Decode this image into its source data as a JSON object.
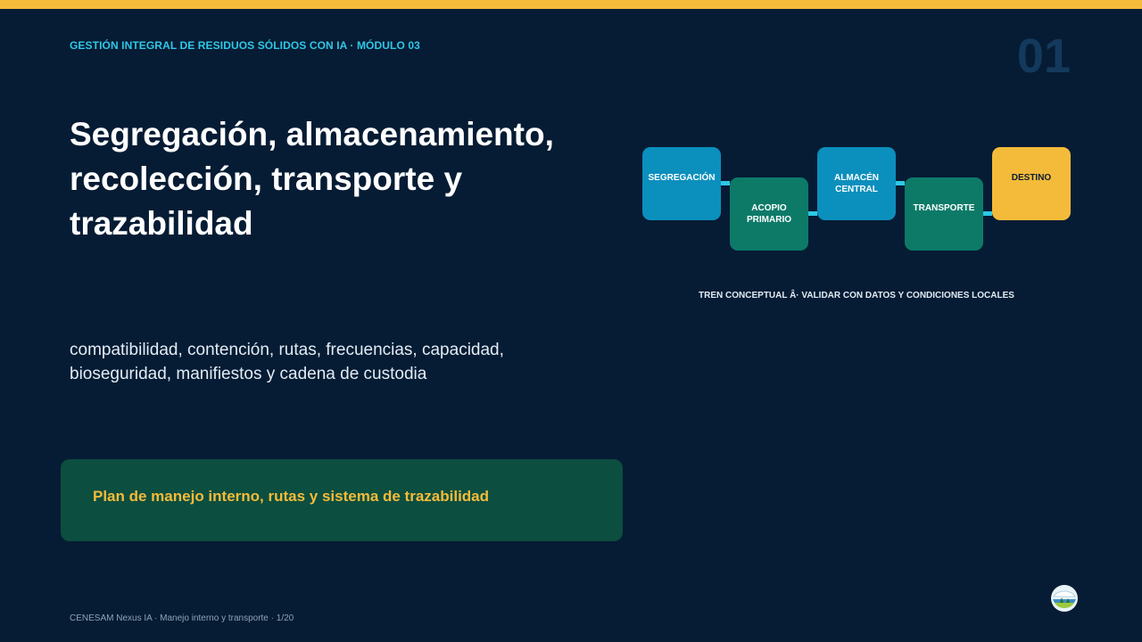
{
  "header": {
    "eyebrow": "GESTIÓN INTEGRAL DE RESIDUOS SÓLIDOS CON IA · MÓDULO 03",
    "slide_number": "01"
  },
  "main": {
    "title": "Segregación, almacenamiento, recolección, transporte y trazabilidad",
    "subtitle": "compatibilidad, contención, rutas, frecuencias, capacidad, bioseguridad, manifiestos y cadena de custodia",
    "callout": "Plan de manejo interno, rutas y sistema de trazabilidad"
  },
  "flow": {
    "steps": [
      {
        "label": "SEGREGACIÓN",
        "color": "#0b8fbd"
      },
      {
        "label": "ACOPIO PRIMARIO",
        "color": "#0d7a68"
      },
      {
        "label": "ALMACÉN CENTRAL",
        "color": "#0b8fbd"
      },
      {
        "label": "TRANSPORTE",
        "color": "#0d7a68"
      },
      {
        "label": "DESTINO",
        "color": "#f4bb3a"
      }
    ],
    "caption": "TREN CONCEPTUAL Â· VALIDAR CON DATOS Y CONDICIONES LOCALES"
  },
  "footer": {
    "text": "CENESAM Nexus IA · Manejo interno y transporte · 1/20"
  },
  "logo": {
    "icon": "institution-logo-icon"
  },
  "colors": {
    "background": "#061c34",
    "accent_yellow": "#f4bb3a",
    "accent_cyan": "#2ec8e6",
    "blue": "#0b8fbd",
    "green": "#0d7a68",
    "callout_bg": "#0c4e3f"
  }
}
